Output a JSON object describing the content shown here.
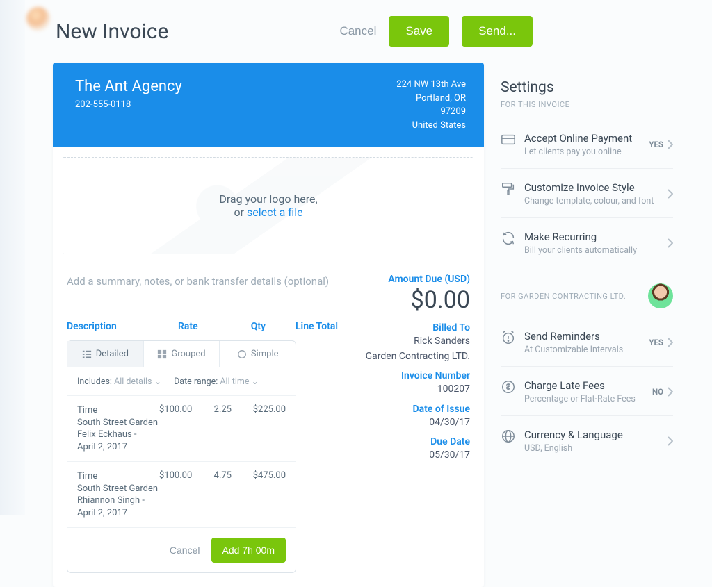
{
  "header": {
    "title": "New Invoice",
    "cancel": "Cancel",
    "save": "Save",
    "send": "Send..."
  },
  "invoice": {
    "company": "The Ant Agency",
    "phone": "202-555-0118",
    "address": {
      "line1": "224 NW 13th Ave",
      "line2": "Portland, OR",
      "line3": "97209",
      "line4": "United States"
    },
    "logo_drop_line1": "Drag your logo here,",
    "logo_drop_line2_prefix": "or ",
    "logo_drop_link": "select a file",
    "summary_placeholder": "Add a summary, notes, or bank transfer details (optional)",
    "amount_due_label": "Amount Due (USD)",
    "amount_due": "$0.00",
    "meta": {
      "billed_to_label": "Billed To",
      "billed_to_name": "Rick Sanders",
      "billed_to_org": "Garden Contracting LTD.",
      "invoice_number_label": "Invoice Number",
      "invoice_number": "100207",
      "date_of_issue_label": "Date of Issue",
      "date_of_issue": "04/30/17",
      "due_date_label": "Due Date",
      "due_date": "05/30/17"
    },
    "columns": {
      "description": "Description",
      "rate": "Rate",
      "qty": "Qty",
      "line_total": "Line Total"
    },
    "items_panel": {
      "tabs": {
        "detailed": "Detailed",
        "grouped": "Grouped",
        "simple": "Simple"
      },
      "filters": {
        "includes_label": "Includes:",
        "includes_value": "All details",
        "range_label": "Date range:",
        "range_value": "All time"
      },
      "items": [
        {
          "type": "Time",
          "line2": "South Street Garden",
          "line3": "Felix Eckhaus -",
          "line4": "April 2, 2017",
          "rate": "$100.00",
          "qty": "2.25",
          "total": "$225.00"
        },
        {
          "type": "Time",
          "line2": "South Street Garden",
          "line3": "Rhiannon Singh -",
          "line4": "April 2, 2017",
          "rate": "$100.00",
          "qty": "4.75",
          "total": "$475.00"
        }
      ],
      "cancel": "Cancel",
      "add": "Add 7h 00m"
    }
  },
  "settings": {
    "heading": "Settings",
    "for_this_invoice": "FOR THIS INVOICE",
    "rows_invoice": [
      {
        "title": "Accept Online Payment",
        "sub": "Let clients pay you online",
        "badge": "YES"
      },
      {
        "title": "Customize Invoice Style",
        "sub": "Change template, colour, and font",
        "badge": ""
      },
      {
        "title": "Make Recurring",
        "sub": "Bill your clients automatically",
        "badge": ""
      }
    ],
    "for_client_label": "FOR GARDEN CONTRACTING LTD.",
    "rows_client": [
      {
        "title": "Send Reminders",
        "sub": "At Customizable Intervals",
        "badge": "YES"
      },
      {
        "title": "Charge Late Fees",
        "sub": "Percentage or Flat-Rate Fees",
        "badge": "NO"
      },
      {
        "title": "Currency & Language",
        "sub": "USD, English",
        "badge": ""
      }
    ]
  }
}
